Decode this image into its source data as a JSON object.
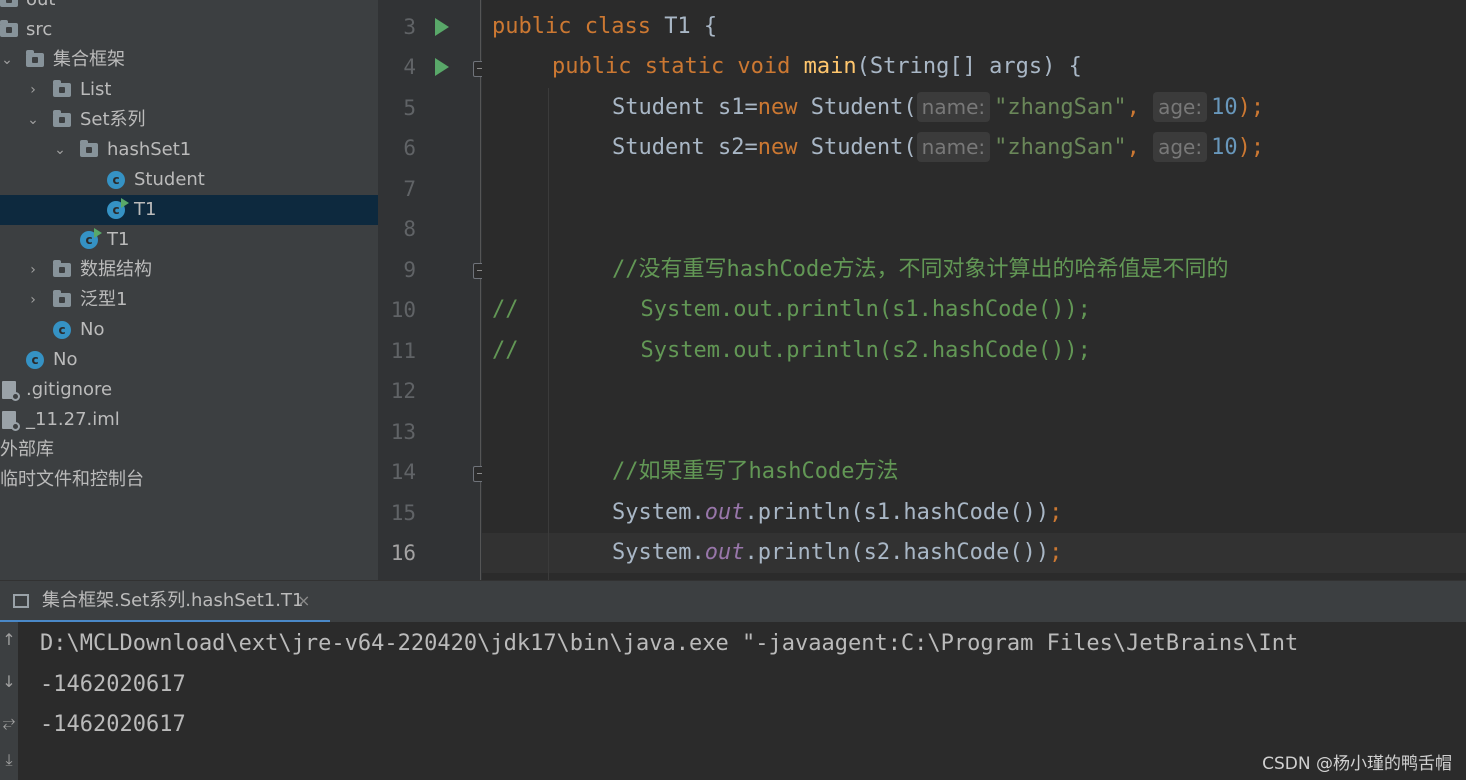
{
  "project_tree": {
    "items": [
      {
        "label": "out",
        "icon": "folder-icon",
        "expanded": null
      },
      {
        "label": "src",
        "icon": "folder-icon",
        "expanded": null
      },
      {
        "label": "集合框架",
        "icon": "folder-icon",
        "expanded": true
      },
      {
        "label": "List",
        "icon": "folder-icon",
        "expanded": false
      },
      {
        "label": "Set系列",
        "icon": "folder-icon",
        "expanded": true
      },
      {
        "label": "hashSet1",
        "icon": "folder-icon",
        "expanded": true
      },
      {
        "label": "Student",
        "icon": "class-icon"
      },
      {
        "label": "T1",
        "icon": "runnable-class-icon",
        "selected": true
      },
      {
        "label": "T1",
        "icon": "runnable-class-icon"
      },
      {
        "label": "数据结构",
        "icon": "folder-icon",
        "expanded": false
      },
      {
        "label": "泛型1",
        "icon": "folder-icon",
        "expanded": false
      },
      {
        "label": "No",
        "icon": "class-icon"
      },
      {
        "label": "No",
        "icon": "class-icon"
      },
      {
        "label": ".gitignore",
        "icon": "file-icon"
      },
      {
        "label": "_11.27.iml",
        "icon": "file-icon"
      },
      {
        "label": "外部库",
        "icon": null
      },
      {
        "label": "临时文件和控制台",
        "icon": null
      }
    ]
  },
  "editor": {
    "current_line": "16",
    "lines": [
      {
        "num": "3",
        "parts": {
          "a": "public class ",
          "b": "T1",
          "c": " {"
        }
      },
      {
        "num": "4",
        "parts": {
          "a": "public static void ",
          "b": "main",
          "c": "(String[] args) {"
        }
      },
      {
        "num": "5",
        "parts": {
          "a": "Student s1=",
          "b": "new",
          "c": " Student(",
          "hint1": "name:",
          "s": "\"zhangSan\"",
          "d": ",",
          "hint2": "age:",
          "n": "10",
          "e": ");"
        }
      },
      {
        "num": "6",
        "parts": {
          "a": "Student s2=",
          "b": "new",
          "c": " Student(",
          "hint1": "name:",
          "s": "\"zhangSan\"",
          "d": ",",
          "hint2": "age:",
          "n": "10",
          "e": ");"
        }
      },
      {
        "num": "7"
      },
      {
        "num": "8"
      },
      {
        "num": "9",
        "parts": {
          "a": "//没有重写hashCode方法，不同对象计算出的哈希值是不同的"
        }
      },
      {
        "num": "10",
        "parts": {
          "a": "//",
          "b": "System.out.println(s1.hashCode());"
        }
      },
      {
        "num": "11",
        "parts": {
          "a": "//",
          "b": "System.out.println(s2.hashCode());"
        }
      },
      {
        "num": "12"
      },
      {
        "num": "13"
      },
      {
        "num": "14",
        "parts": {
          "a": "//如果重写了hashCode方法"
        }
      },
      {
        "num": "15",
        "parts": {
          "a": "System.",
          "b": "out",
          "c": ".println(s1.hashCode())",
          "d": ";"
        }
      },
      {
        "num": "16",
        "parts": {
          "a": "System.",
          "b": "out",
          "c": ".println(s2.hashCode())",
          "d": ";"
        }
      }
    ]
  },
  "run_panel": {
    "tab_label": "集合框架.Set系列.hashSet1.T1",
    "tab_close": "×",
    "output": [
      "D:\\MCLDownload\\ext\\jre-v64-220420\\jdk17\\bin\\java.exe \"-javaagent:C:\\Program Files\\JetBrains\\Int",
      "-1462020617",
      "-1462020617"
    ]
  },
  "watermark": "CSDN @杨小瑾的鸭舌帽",
  "colors": {
    "keyword": "#cc7832",
    "method": "#ffc66d",
    "string": "#6a8759",
    "number": "#6897bb",
    "comment": "#629755",
    "static_field": "#9876aa",
    "selection": "#0d293e",
    "run_icon": "#59a869",
    "tab_underline": "#4a88c7"
  }
}
